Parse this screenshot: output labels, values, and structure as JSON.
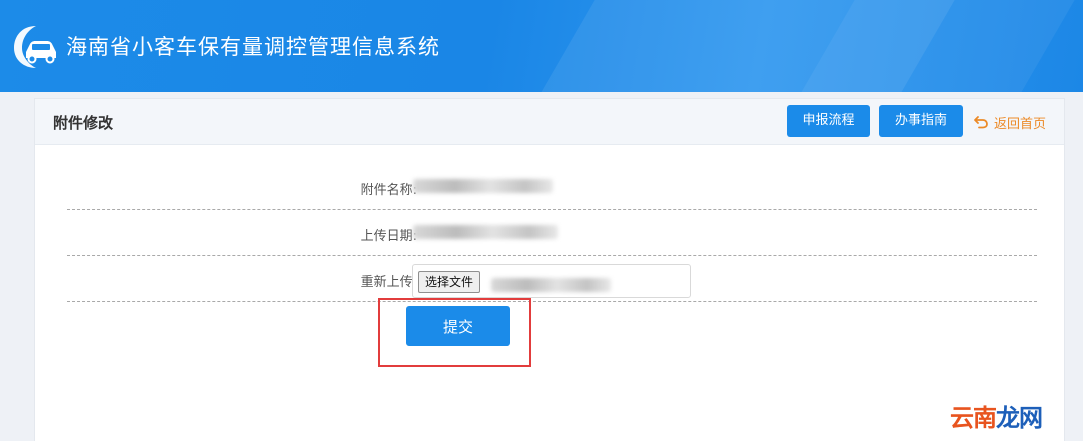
{
  "header": {
    "title": "海南省小客车保有量调控管理信息系统",
    "logo_icon": "car-logo-icon"
  },
  "panel": {
    "title": "附件修改",
    "buttons": {
      "flow": "申报流程",
      "guide": "办事指南"
    },
    "back_home": {
      "label": "返回首页",
      "icon": "return-arrow-icon"
    }
  },
  "form": {
    "rows": [
      {
        "label": "附件名称:"
      },
      {
        "label": "上传日期:"
      },
      {
        "label": "重新上传:"
      }
    ],
    "file_button": "选择文件",
    "submit": "提交"
  },
  "watermark": {
    "part1": "云南",
    "part2": "龙网"
  },
  "colors": {
    "header_blue": "#1c8be8",
    "button_blue": "#1b8be9",
    "back_home_orange": "#ec8a27",
    "highlight_red": "#e23c3c"
  }
}
